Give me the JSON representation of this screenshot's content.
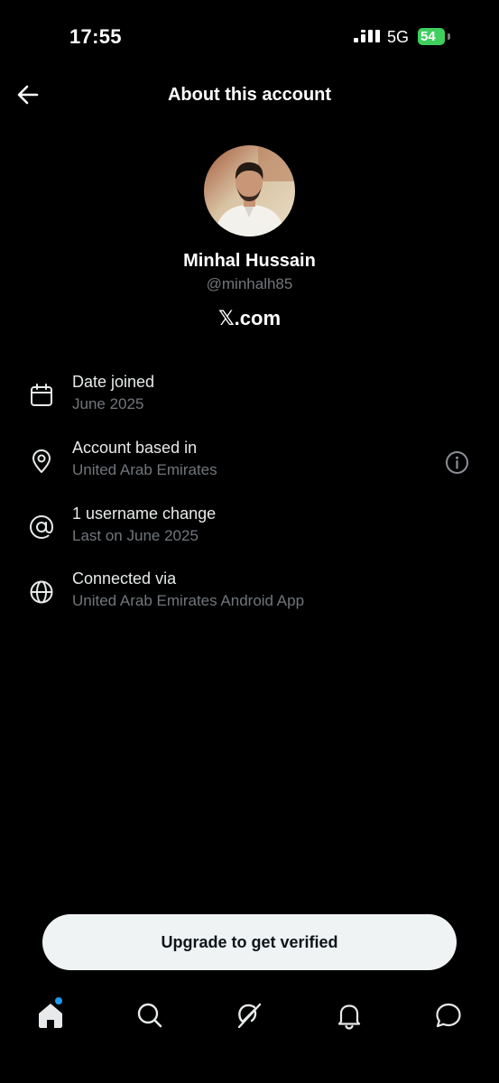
{
  "status_bar": {
    "time": "17:55",
    "network": "5G",
    "battery": "54"
  },
  "header": {
    "title": "About this account"
  },
  "profile": {
    "name": "Minhal Hussain",
    "handle": "@minhalh85",
    "platform": "𝕏.com"
  },
  "details": [
    {
      "title": "Date joined",
      "subtitle": "June 2025",
      "icon": "calendar-icon"
    },
    {
      "title": "Account based in",
      "subtitle": "United Arab Emirates",
      "icon": "location-pin-icon"
    },
    {
      "title": "1 username change",
      "subtitle": "Last on June 2025",
      "icon": "at-sign-icon"
    },
    {
      "title": "Connected via",
      "subtitle": "United Arab Emirates Android App",
      "icon": "globe-icon"
    }
  ],
  "cta": {
    "label": "Upgrade to get verified"
  },
  "nav": {
    "items": [
      "home-icon",
      "search-icon",
      "grok-icon",
      "bell-icon",
      "messages-icon"
    ],
    "active": "home-icon"
  },
  "colors": {
    "background": "#000000",
    "text": "#e7e9ea",
    "muted": "#71767b",
    "accent": "#1d9bf0",
    "button_bg": "#eff3f4"
  }
}
